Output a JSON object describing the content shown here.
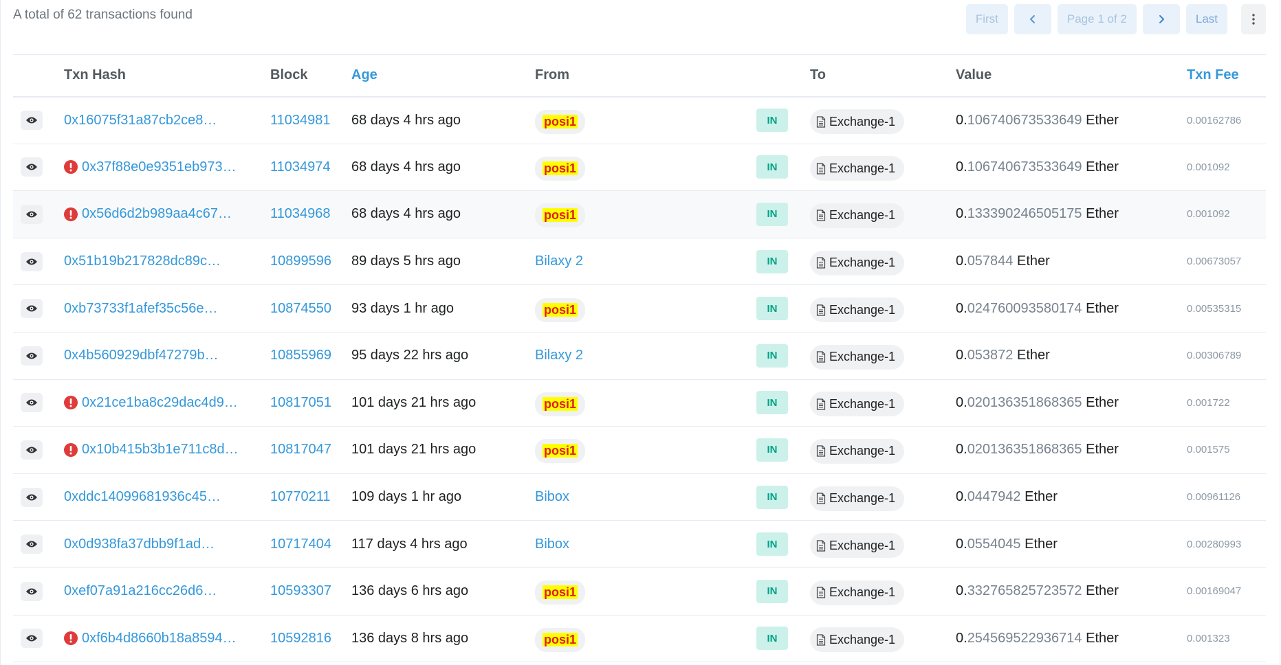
{
  "summary": "A total of 62 transactions found",
  "pagination": {
    "first": "First",
    "page": "Page 1 of 2",
    "last": "Last"
  },
  "colors": {
    "link": "#3498db",
    "in_badge_bg": "#ccf1ea",
    "in_badge_text": "#00a186",
    "error": "#de3b3b",
    "highlight_bg": "#ffff00",
    "highlight_text": "#de1e1e"
  },
  "columns": {
    "hash": "Txn Hash",
    "block": "Block",
    "age": "Age",
    "from": "From",
    "to": "To",
    "value": "Value",
    "fee": "Txn Fee"
  },
  "rows": [
    {
      "error": false,
      "hash": "0x16075f31a87cb2ce8…",
      "block": "11034981",
      "age": "68 days 4 hrs ago",
      "from": "posi1",
      "from_highlight": true,
      "direction": "IN",
      "to": "Exchange-1",
      "value_int": "0.",
      "value_dec": "106740673533649",
      "unit": "Ether",
      "fee": "0.00162786"
    },
    {
      "error": true,
      "hash": "0x37f88e0e9351eb973…",
      "block": "11034974",
      "age": "68 days 4 hrs ago",
      "from": "posi1",
      "from_highlight": true,
      "direction": "IN",
      "to": "Exchange-1",
      "value_int": "0.",
      "value_dec": "106740673533649",
      "unit": "Ether",
      "fee": "0.001092"
    },
    {
      "error": true,
      "hash": "0x56d6d2b989aa4c67…",
      "block": "11034968",
      "age": "68 days 4 hrs ago",
      "from": "posi1",
      "from_highlight": true,
      "direction": "IN",
      "to": "Exchange-1",
      "value_int": "0.",
      "value_dec": "133390246505175",
      "unit": "Ether",
      "fee": "0.001092"
    },
    {
      "error": false,
      "hash": "0x51b19b217828dc89c…",
      "block": "10899596",
      "age": "89 days 5 hrs ago",
      "from": "Bilaxy 2",
      "from_highlight": false,
      "direction": "IN",
      "to": "Exchange-1",
      "value_int": "0.",
      "value_dec": "057844",
      "unit": "Ether",
      "fee": "0.00673057"
    },
    {
      "error": false,
      "hash": "0xb73733f1afef35c56e…",
      "block": "10874550",
      "age": "93 days 1 hr ago",
      "from": "posi1",
      "from_highlight": true,
      "direction": "IN",
      "to": "Exchange-1",
      "value_int": "0.",
      "value_dec": "024760093580174",
      "unit": "Ether",
      "fee": "0.00535315"
    },
    {
      "error": false,
      "hash": "0x4b560929dbf47279b…",
      "block": "10855969",
      "age": "95 days 22 hrs ago",
      "from": "Bilaxy 2",
      "from_highlight": false,
      "direction": "IN",
      "to": "Exchange-1",
      "value_int": "0.",
      "value_dec": "053872",
      "unit": "Ether",
      "fee": "0.00306789"
    },
    {
      "error": true,
      "hash": "0x21ce1ba8c29dac4d9…",
      "block": "10817051",
      "age": "101 days 21 hrs ago",
      "from": "posi1",
      "from_highlight": true,
      "direction": "IN",
      "to": "Exchange-1",
      "value_int": "0.",
      "value_dec": "020136351868365",
      "unit": "Ether",
      "fee": "0.001722"
    },
    {
      "error": true,
      "hash": "0x10b415b3b1e711c8d…",
      "block": "10817047",
      "age": "101 days 21 hrs ago",
      "from": "posi1",
      "from_highlight": true,
      "direction": "IN",
      "to": "Exchange-1",
      "value_int": "0.",
      "value_dec": "020136351868365",
      "unit": "Ether",
      "fee": "0.001575"
    },
    {
      "error": false,
      "hash": "0xddc14099681936c45…",
      "block": "10770211",
      "age": "109 days 1 hr ago",
      "from": "Bibox",
      "from_highlight": false,
      "direction": "IN",
      "to": "Exchange-1",
      "value_int": "0.",
      "value_dec": "0447942",
      "unit": "Ether",
      "fee": "0.00961126"
    },
    {
      "error": false,
      "hash": "0x0d938fa37dbb9f1ad…",
      "block": "10717404",
      "age": "117 days 4 hrs ago",
      "from": "Bibox",
      "from_highlight": false,
      "direction": "IN",
      "to": "Exchange-1",
      "value_int": "0.",
      "value_dec": "0554045",
      "unit": "Ether",
      "fee": "0.00280993"
    },
    {
      "error": false,
      "hash": "0xef07a91a216cc26d6…",
      "block": "10593307",
      "age": "136 days 6 hrs ago",
      "from": "posi1",
      "from_highlight": true,
      "direction": "IN",
      "to": "Exchange-1",
      "value_int": "0.",
      "value_dec": "332765825723572",
      "unit": "Ether",
      "fee": "0.00169047"
    },
    {
      "error": true,
      "hash": "0xf6b4d8660b18a8594…",
      "block": "10592816",
      "age": "136 days 8 hrs ago",
      "from": "posi1",
      "from_highlight": true,
      "direction": "IN",
      "to": "Exchange-1",
      "value_int": "0.",
      "value_dec": "254569522936714",
      "unit": "Ether",
      "fee": "0.001323"
    }
  ]
}
